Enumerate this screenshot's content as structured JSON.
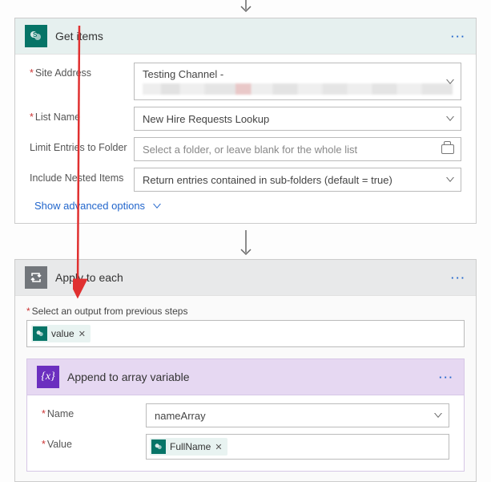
{
  "getItems": {
    "title": "Get items",
    "fields": {
      "siteAddress": {
        "label": "Site Address",
        "value": "Testing Channel -"
      },
      "listName": {
        "label": "List Name",
        "value": "New Hire Requests Lookup"
      },
      "limitFolder": {
        "label": "Limit Entries to Folder",
        "placeholder": "Select a folder, or leave blank for the whole list"
      },
      "includeNested": {
        "label": "Include Nested Items",
        "value": "Return entries contained in sub-folders (default = true)"
      }
    },
    "advanced": "Show advanced options"
  },
  "applyEach": {
    "title": "Apply to each",
    "selectLabel": "Select an output from previous steps",
    "token": "value"
  },
  "appendVar": {
    "title": "Append to array variable",
    "fields": {
      "name": {
        "label": "Name",
        "value": "nameArray"
      },
      "value": {
        "label": "Value",
        "token": "FullName"
      }
    }
  }
}
